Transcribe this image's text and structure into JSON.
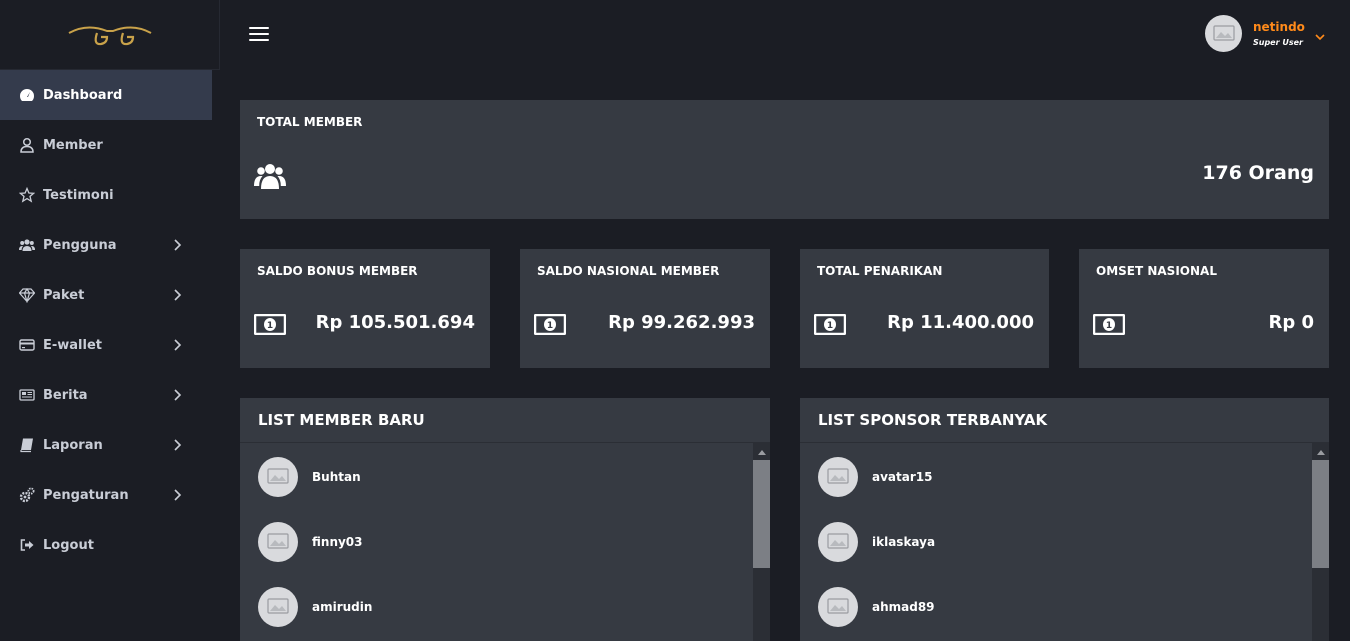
{
  "sidebar": {
    "items": [
      {
        "label": "Dashboard",
        "icon": "dashboard-gauge-icon",
        "active": true,
        "has_children": false
      },
      {
        "label": "Member",
        "icon": "user-icon",
        "active": false,
        "has_children": false
      },
      {
        "label": "Testimoni",
        "icon": "star-icon",
        "active": false,
        "has_children": false
      },
      {
        "label": "Pengguna",
        "icon": "users-icon",
        "active": false,
        "has_children": true
      },
      {
        "label": "Paket",
        "icon": "diamond-icon",
        "active": false,
        "has_children": true
      },
      {
        "label": "E-wallet",
        "icon": "credit-card-icon",
        "active": false,
        "has_children": true
      },
      {
        "label": "Berita",
        "icon": "newspaper-icon",
        "active": false,
        "has_children": true
      },
      {
        "label": "Laporan",
        "icon": "book-icon",
        "active": false,
        "has_children": true
      },
      {
        "label": "Pengaturan",
        "icon": "gears-icon",
        "active": false,
        "has_children": true
      },
      {
        "label": "Logout",
        "icon": "sign-out-icon",
        "active": false,
        "has_children": false
      }
    ]
  },
  "user": {
    "name": "netindo",
    "role": "Super User"
  },
  "total_member": {
    "title": "TOTAL MEMBER",
    "value": "176 Orang"
  },
  "stats": [
    {
      "title": "SALDO BONUS MEMBER",
      "value": "Rp 105.501.694"
    },
    {
      "title": "SALDO NASIONAL MEMBER",
      "value": "Rp 99.262.993"
    },
    {
      "title": "TOTAL PENARIKAN",
      "value": "Rp 11.400.000"
    },
    {
      "title": "OMSET NASIONAL",
      "value": "Rp 0"
    }
  ],
  "list_member_baru": {
    "title": "LIST MEMBER BARU",
    "items": [
      "Buhtan",
      "finny03",
      "amirudin"
    ]
  },
  "list_sponsor": {
    "title": "LIST SPONSOR TERBANYAK",
    "items": [
      "avatar15",
      "iklaskaya",
      "ahmad89"
    ]
  },
  "colors": {
    "accent": "#ff8a1a",
    "background": "#1b1d24",
    "card": "#363a42",
    "active_nav": "#343b4c",
    "logo": "#c9a24a"
  }
}
